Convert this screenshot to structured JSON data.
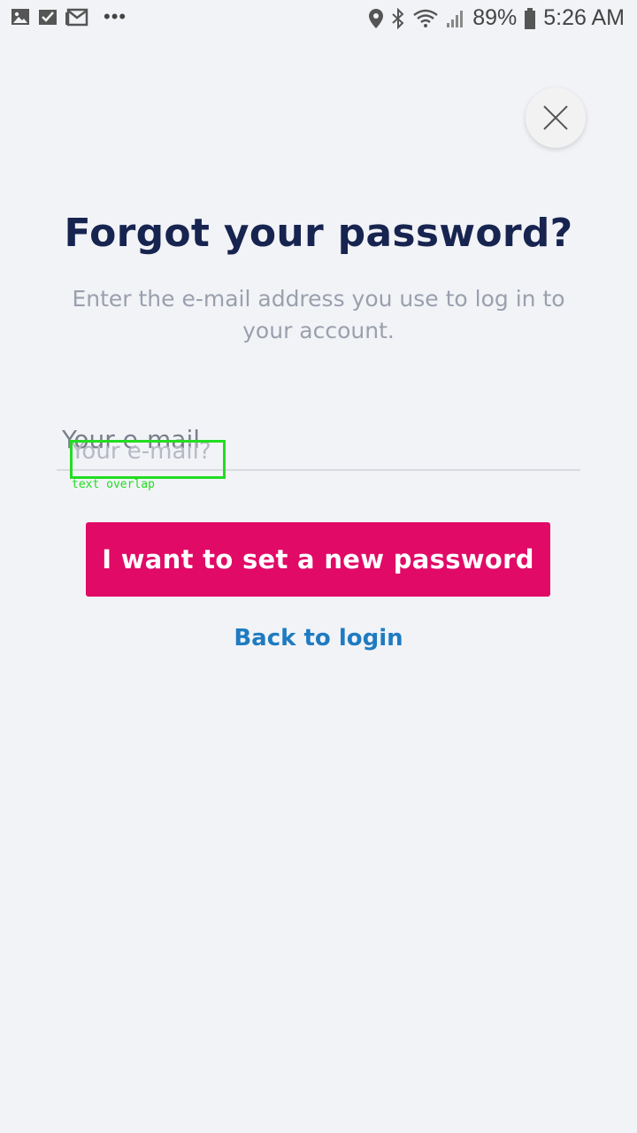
{
  "status_bar": {
    "battery": "89%",
    "time": "5:26 AM",
    "left_icons": [
      "gallery-icon",
      "checklist-icon",
      "gmail-icon",
      "more-dots-icon"
    ],
    "right_icons": [
      "location-pin-icon",
      "bluetooth-icon",
      "wifi-icon",
      "signal-icon",
      "battery-icon"
    ]
  },
  "close": {
    "icon": "close-icon"
  },
  "page": {
    "title": "Forgot your password?",
    "subtitle": "Enter the e-mail address you use to log in to your account."
  },
  "email": {
    "label": "Your e-mail",
    "placeholder": "Your e-mail?"
  },
  "overlay": {
    "tag": "text overlap",
    "color": "#22dd22"
  },
  "actions": {
    "submit_label": "I want to set a new password",
    "back_label": "Back to login"
  },
  "colors": {
    "background": "#f2f3f7",
    "title": "#172450",
    "primary": "#e10a67",
    "link": "#1f7bc1"
  }
}
